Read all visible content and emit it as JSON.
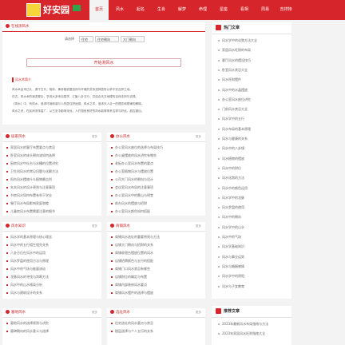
{
  "header": {
    "logo_text": "好安园",
    "logo_sub": "haoanyuan.com",
    "nav": [
      "首页",
      "风水",
      "起名",
      "生肖",
      "解梦",
      "命理",
      "星座",
      "看相",
      "周易",
      "吉祥物"
    ]
  },
  "tool": {
    "title": "在线测风水",
    "label": "请选择",
    "select1": "住宅",
    "select2": "住宅朝向",
    "select3": "大门朝向",
    "button": "开始测风水",
    "intro_title": "风水术简介",
    "intro_lines": [
      "风水术由来已久，源于古代，相传，黄帝曾依据自然与环境的关系选择居所以求平安吉祥之地。",
      "在古，风水术的演变繁杂，学说大多来自易学，汇聚八卦五行，并结合天文地理的自然法则与实践。",
      "《风水》中，有风水，追求环境和谐与人的居住舒适感，风水之学，追求天人合一的理念和规律的解释。",
      "风水之说，在民间流传甚广，从古至今影响深远，人们相信良好的风水能够带来吉祥与好运，趋吉避凶。"
    ]
  },
  "sections": {
    "home": {
      "title": "居家风水",
      "more": "更多",
      "items": [
        "家居风水的客厅布置要点与禁忌",
        "卧室风水的床头朝向该如何选择",
        "厨房风水中灶台与水槽的位置讲究",
        "卫生间风水的常见问题与化解方法",
        "阳台风水摆放什么植物最吉利",
        "玄关风水的设计原则与注意事项",
        "书房风水如何布置有利于学业",
        "餐厅风水布局影响家庭和睦",
        "儿童房风水布置需要注意的细节"
      ]
    },
    "office": {
      "title": "办公风水",
      "more": "更多",
      "items": [
        "办公室风水座位的选择与布局技巧",
        "办公桌摆放的风水讲究有哪些",
        "老板办公室风水布置的要点",
        "办公室植物风水与摆放位置",
        "公司大门风水的朝向与设计",
        "会议室风水布局的注意事项",
        "办公室风水中的靠山与明堂",
        "前台风水的摆放与招财",
        "办公室风水颜色如何搭配"
      ]
    },
    "feng_lore": {
      "title": "风水知识",
      "more": "更多",
      "items": [
        "风水学的基本原理与核心理念",
        "风水中的五行相生相克关系",
        "八卦方位在风水中的运用",
        "风水罗盘的使用方法与原理",
        "风水中的气场与能量流动",
        "龙脉风水的寻找与判断方法",
        "风水中的山水格局分析",
        "风水与建筑设计的关系"
      ]
    },
    "shop": {
      "title": "商铺风水",
      "more": "更多",
      "items": [
        "商铺风水选址的重要原则与方法",
        "店铺大门朝向与招财的关系",
        "商铺收银台摆放位置的风水",
        "店铺招牌颜色与五行的搭配",
        "商铺门口风水禁忌有哪些",
        "店铺财位的确定与布置",
        "商铺内部装修风水要点",
        "商铺风水摆件的选择与摆放"
      ]
    },
    "grave": {
      "title": "墓地风水",
      "more": "更多",
      "items": [
        "墓地风水的选择原则与讲究",
        "墓碑朝向的风水意义与选择"
      ]
    },
    "xuanzhi": {
      "title": "选址风水",
      "more": "更多",
      "items": [
        "住宅选址的风水要点与禁忌",
        "楼层选择与个人五行的关系"
      ]
    }
  },
  "sidebar": {
    "hot_title": "热门文章",
    "hot_items": [
      "风水学中的化煞方法大全",
      "家居风水旺财的布局",
      "客厅风水的摆设技巧",
      "卧室风水禁忌大全",
      "风水旺财摆件",
      "风水中的水晶摆放",
      "办公室风水座位讲究",
      "门前风水禁忌大全",
      "风水学中的五行",
      "风水布局的基本原理",
      "风水与健康的关系",
      "风水中的八卦镜",
      "风水植物的摆放",
      "风水中的财位",
      "风水化煞的方法",
      "风水中的颜色运用",
      "风水学中的龙脉",
      "风水罗盘的使用",
      "风水中的朝向",
      "风水学中的山水",
      "风水中的气场",
      "风水学基础知识",
      "风水与事业运势",
      "风水与婚姻感情",
      "风水学中的阴阳",
      "风水与子女教育"
    ],
    "rec_title": "推荐文章",
    "rec_items": [
      "2023年最新风水布局指南与方法",
      "2023年家居风水旺财指南大全"
    ]
  }
}
